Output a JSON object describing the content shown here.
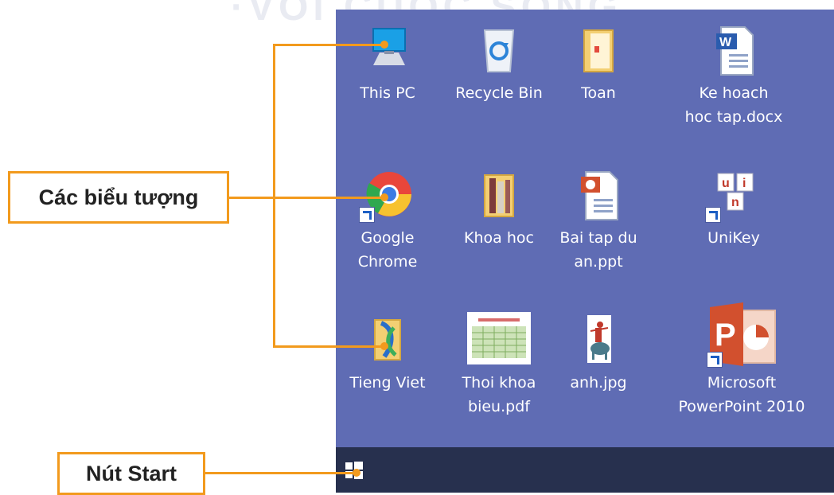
{
  "callouts": {
    "icons_label": "Các biểu tượng",
    "start_label": "Nút Start"
  },
  "desktop": {
    "icons": [
      {
        "name": "this-pc",
        "label_lines": [
          "This PC"
        ]
      },
      {
        "name": "recycle-bin",
        "label_lines": [
          "Recycle Bin"
        ]
      },
      {
        "name": "toan-folder",
        "label_lines": [
          "Toan"
        ]
      },
      {
        "name": "ke-hoach-doc",
        "label_lines": [
          "Ke hoach",
          "hoc tap.docx"
        ]
      },
      {
        "name": "google-chrome",
        "label_lines": [
          "Google",
          "Chrome"
        ]
      },
      {
        "name": "khoa-hoc-folder",
        "label_lines": [
          "Khoa hoc"
        ]
      },
      {
        "name": "bai-tap-ppt",
        "label_lines": [
          "Bai tap du",
          "an.ppt"
        ]
      },
      {
        "name": "unikey",
        "label_lines": [
          "UniKey"
        ]
      },
      {
        "name": "tieng-viet",
        "label_lines": [
          "Tieng Viet"
        ]
      },
      {
        "name": "thoi-khoa-bieu-pdf",
        "label_lines": [
          "Thoi khoa",
          "bieu.pdf"
        ]
      },
      {
        "name": "anh-jpg",
        "label_lines": [
          "anh.jpg"
        ]
      },
      {
        "name": "powerpoint-2010",
        "label_lines": [
          "Microsoft",
          "PowerPoint 2010"
        ]
      }
    ]
  },
  "colors": {
    "desktop": "#5f6cb4",
    "taskbar": "#27304e",
    "accent": "#f29a1d"
  }
}
